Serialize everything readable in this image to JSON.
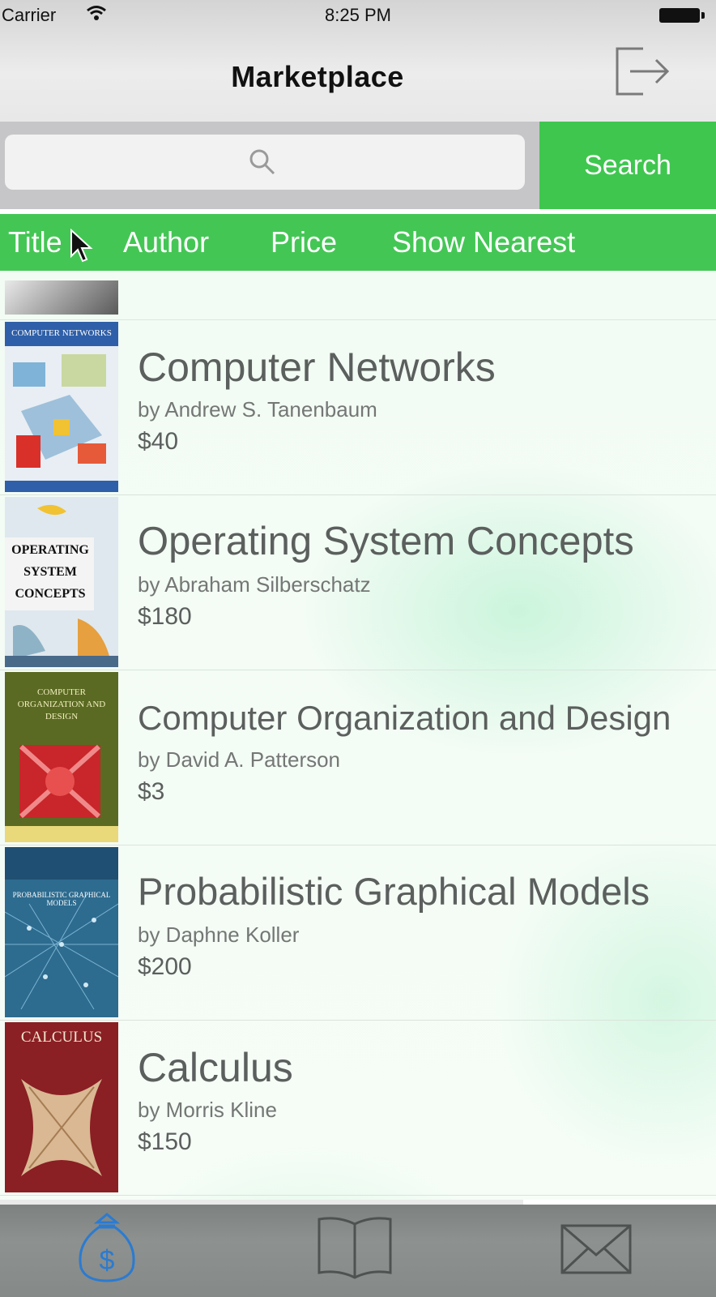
{
  "status_bar": {
    "carrier": "Carrier",
    "time": "8:25 PM"
  },
  "nav": {
    "title": "Marketplace",
    "logout_icon": "logout-icon"
  },
  "search": {
    "placeholder": "",
    "button_label": "Search",
    "icon": "search-icon"
  },
  "sort_options": [
    "Title",
    "Author",
    "Price",
    "Show Nearest"
  ],
  "colors": {
    "accent_green": "#44c655",
    "tab_selected": "#2b7bd1"
  },
  "books": [
    {
      "title": "Computer Networks",
      "author": "by Andrew S. Tanenbaum",
      "price": "$40",
      "cover_text": "COMPUTER NETWORKS"
    },
    {
      "title": "Operating System Concepts",
      "author": "by Abraham Silberschatz",
      "price": "$180",
      "cover_text": "OPERATING SYSTEM CONCEPTS"
    },
    {
      "title": "Computer Organization and Design",
      "author": "by David A. Patterson",
      "price": "$3",
      "cover_text": "COMPUTER ORGANIZATION AND DESIGN"
    },
    {
      "title": "Probabilistic Graphical Models",
      "author": "by Daphne Koller",
      "price": "$200",
      "cover_text": "PROBABILISTIC GRAPHICAL MODELS"
    },
    {
      "title": "Calculus",
      "author": "by Morris Kline",
      "price": "$150",
      "cover_text": "CALCULUS"
    }
  ],
  "tabs": [
    {
      "icon": "money-bag-icon",
      "selected": true
    },
    {
      "icon": "book-icon",
      "selected": false
    },
    {
      "icon": "envelope-icon",
      "selected": false
    }
  ]
}
